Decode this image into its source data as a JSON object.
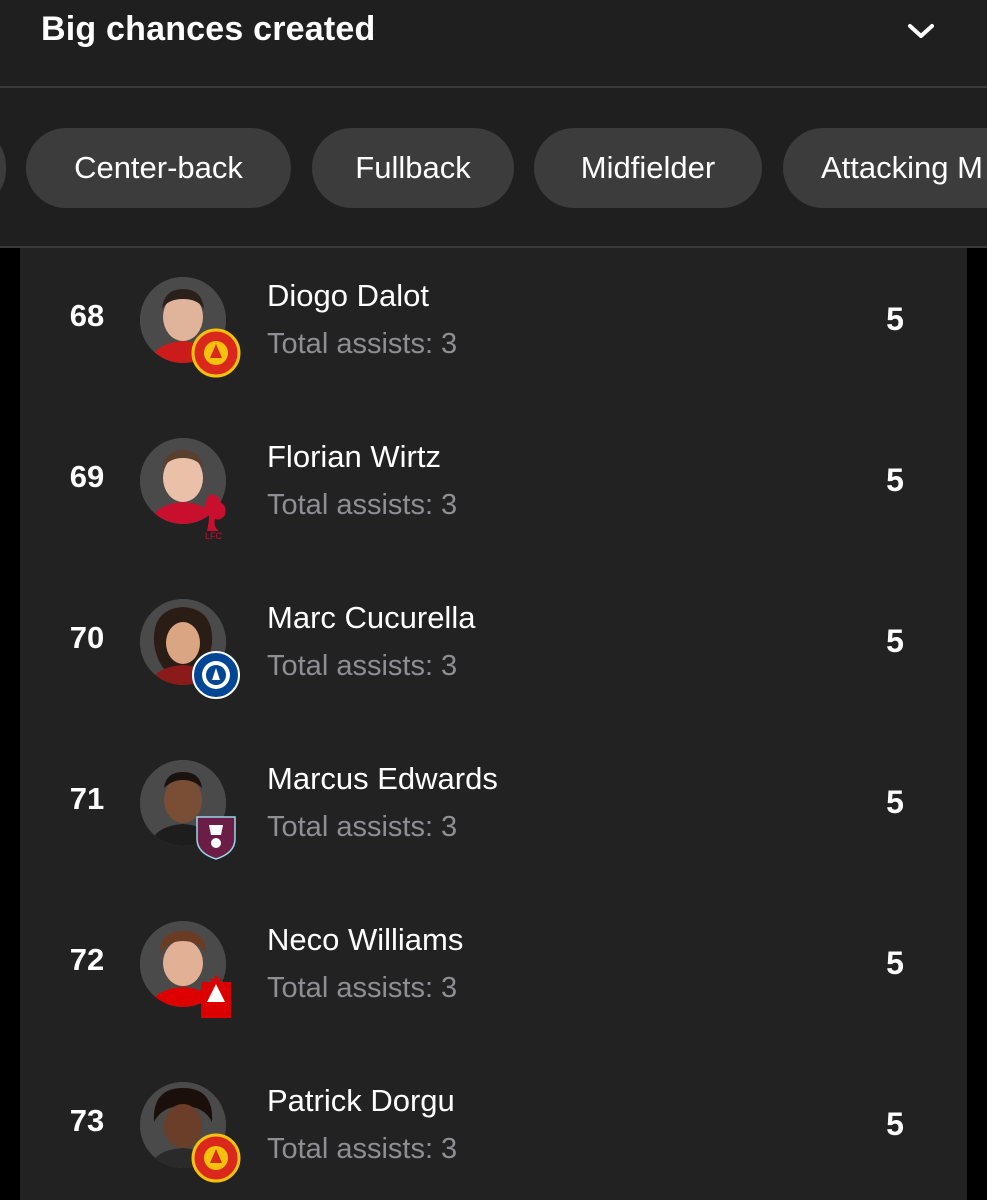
{
  "header": {
    "title": "Big chances created"
  },
  "chips": {
    "partial": "",
    "center_back": "Center-back",
    "fullback": "Fullback",
    "midfielder": "Midfielder",
    "attacking": "Attacking M"
  },
  "players": [
    {
      "rank": "68",
      "name": "Diogo Dalot",
      "sub": "Total assists: 3",
      "value": "5",
      "club_icon": "manchester-united-crest-icon"
    },
    {
      "rank": "69",
      "name": "Florian Wirtz",
      "sub": "Total assists: 3",
      "value": "5",
      "club_icon": "liverpool-crest-icon"
    },
    {
      "rank": "70",
      "name": "Marc Cucurella",
      "sub": "Total assists: 3",
      "value": "5",
      "club_icon": "chelsea-crest-icon"
    },
    {
      "rank": "71",
      "name": "Marcus Edwards",
      "sub": "Total assists: 3",
      "value": "5",
      "club_icon": "burnley-crest-icon"
    },
    {
      "rank": "72",
      "name": "Neco Williams",
      "sub": "Total assists: 3",
      "value": "5",
      "club_icon": "nottingham-forest-crest-icon"
    },
    {
      "rank": "73",
      "name": "Patrick Dorgu",
      "sub": "Total assists: 3",
      "value": "5",
      "club_icon": "manchester-united-crest-icon"
    }
  ],
  "colors": {
    "background": "#222222",
    "panel": "#1f1f1f",
    "chip": "#3c3c3c",
    "muted_text": "#8e8e93",
    "man_utd_red": "#da291c",
    "liverpool_red": "#c8102e",
    "chelsea_blue": "#034694",
    "burnley_claret": "#6c1d45",
    "forest_red": "#dd0000"
  }
}
